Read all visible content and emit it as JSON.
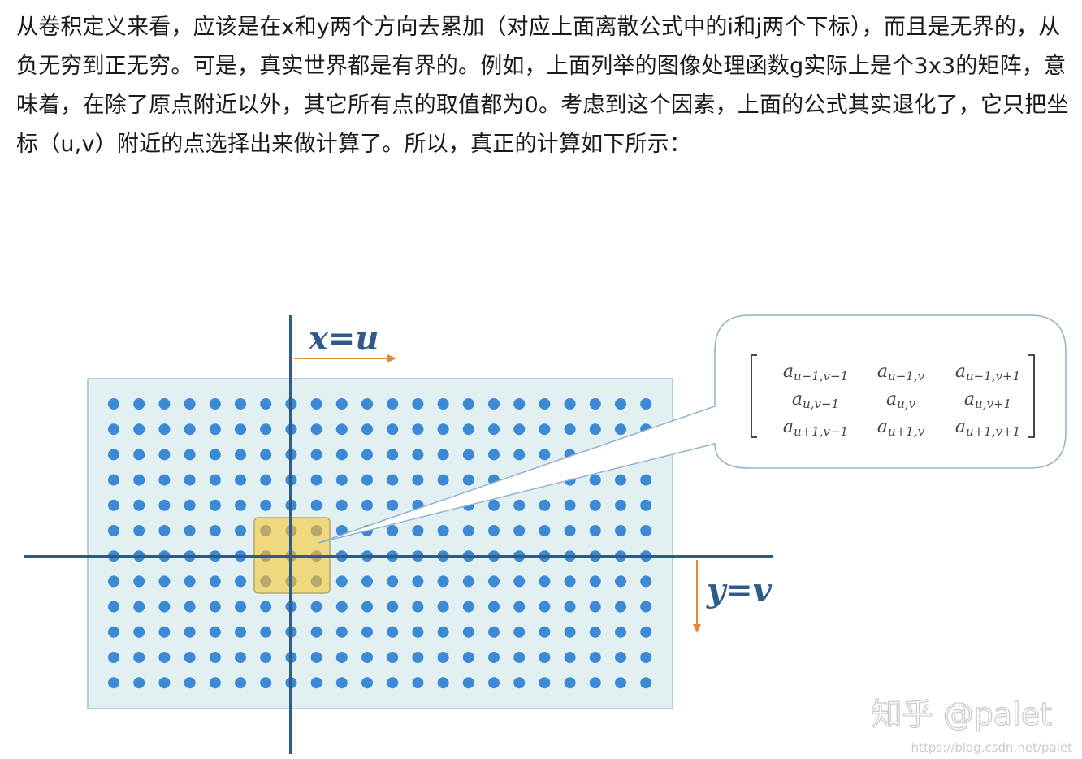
{
  "article": {
    "paragraph": "从卷积定义来看，应该是在x和y两个方向去累加（对应上面离散公式中的i和j两个下标），而且是无界的，从负无穷到正无穷。可是，真实世界都是有界的。例如，上面列举的图像处理函数g实际上是个3x3的矩阵，意味着，在除了原点附近以外，其它所有点的取值都为0。考虑到这个因素，上面的公式其实退化了，它只把坐标（u,v）附近的点选择出来做计算了。所以，真正的计算如下所示："
  },
  "figure": {
    "x_axis_label": "x=u",
    "y_axis_label": "y=v",
    "grid": {
      "rows": 12,
      "cols": 22
    },
    "colors": {
      "dot": "#3c8ad6",
      "panel_fill": "#e3f0f2",
      "panel_border": "#9cc4ce",
      "axis": "#2e5b88",
      "highlight_fill": "#f1d36a",
      "highlight_border": "#b5a468",
      "arrow": "#e08a3c",
      "callout_border": "#8fb3cf",
      "matrix_text": "#444444"
    },
    "matrix": [
      [
        "a_{u-1,v-1}",
        "a_{u-1,v}",
        "a_{u-1,v+1}"
      ],
      [
        "a_{u,v-1}",
        "a_{u,v}",
        "a_{u,v+1}"
      ],
      [
        "a_{u+1,v-1}",
        "a_{u+1,v}",
        "a_{u+1,v+1}"
      ]
    ]
  },
  "watermark": {
    "site": "知乎 @palet",
    "url": "https://blog.csdn.net/palet"
  }
}
